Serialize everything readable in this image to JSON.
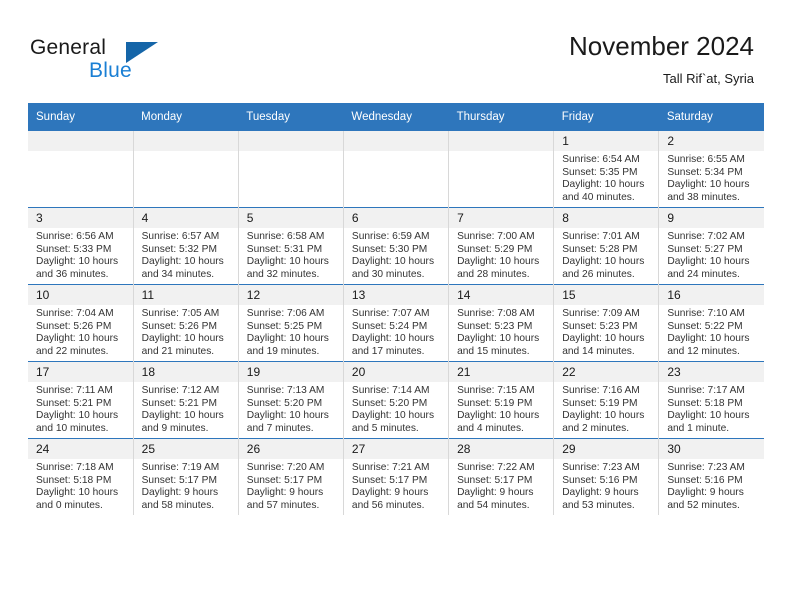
{
  "logo": {
    "word1": "General",
    "word2": "Blue",
    "triangle_color": "#1565a8",
    "blue_color": "#1a7fd4",
    "icon": "triangle-icon"
  },
  "header": {
    "title": "November 2024",
    "subtitle": "Tall Rif`at, Syria"
  },
  "theme": {
    "header_bg": "#2e76bc",
    "daynum_bg": "#f1f1f1",
    "cell_border": "#d8d8d8",
    "week_divider": "#2e76bc"
  },
  "weekdays": [
    "Sunday",
    "Monday",
    "Tuesday",
    "Wednesday",
    "Thursday",
    "Friday",
    "Saturday"
  ],
  "labels": {
    "sunrise": "Sunrise:",
    "sunset": "Sunset:",
    "daylight": "Daylight:"
  },
  "weeks": [
    [
      {
        "day": "",
        "empty": true
      },
      {
        "day": "",
        "empty": true
      },
      {
        "day": "",
        "empty": true
      },
      {
        "day": "",
        "empty": true
      },
      {
        "day": "",
        "empty": true
      },
      {
        "day": "1",
        "sunrise": "Sunrise: 6:54 AM",
        "sunset": "Sunset: 5:35 PM",
        "daylight": "Daylight: 10 hours and 40 minutes."
      },
      {
        "day": "2",
        "sunrise": "Sunrise: 6:55 AM",
        "sunset": "Sunset: 5:34 PM",
        "daylight": "Daylight: 10 hours and 38 minutes."
      }
    ],
    [
      {
        "day": "3",
        "sunrise": "Sunrise: 6:56 AM",
        "sunset": "Sunset: 5:33 PM",
        "daylight": "Daylight: 10 hours and 36 minutes."
      },
      {
        "day": "4",
        "sunrise": "Sunrise: 6:57 AM",
        "sunset": "Sunset: 5:32 PM",
        "daylight": "Daylight: 10 hours and 34 minutes."
      },
      {
        "day": "5",
        "sunrise": "Sunrise: 6:58 AM",
        "sunset": "Sunset: 5:31 PM",
        "daylight": "Daylight: 10 hours and 32 minutes."
      },
      {
        "day": "6",
        "sunrise": "Sunrise: 6:59 AM",
        "sunset": "Sunset: 5:30 PM",
        "daylight": "Daylight: 10 hours and 30 minutes."
      },
      {
        "day": "7",
        "sunrise": "Sunrise: 7:00 AM",
        "sunset": "Sunset: 5:29 PM",
        "daylight": "Daylight: 10 hours and 28 minutes."
      },
      {
        "day": "8",
        "sunrise": "Sunrise: 7:01 AM",
        "sunset": "Sunset: 5:28 PM",
        "daylight": "Daylight: 10 hours and 26 minutes."
      },
      {
        "day": "9",
        "sunrise": "Sunrise: 7:02 AM",
        "sunset": "Sunset: 5:27 PM",
        "daylight": "Daylight: 10 hours and 24 minutes."
      }
    ],
    [
      {
        "day": "10",
        "sunrise": "Sunrise: 7:04 AM",
        "sunset": "Sunset: 5:26 PM",
        "daylight": "Daylight: 10 hours and 22 minutes."
      },
      {
        "day": "11",
        "sunrise": "Sunrise: 7:05 AM",
        "sunset": "Sunset: 5:26 PM",
        "daylight": "Daylight: 10 hours and 21 minutes."
      },
      {
        "day": "12",
        "sunrise": "Sunrise: 7:06 AM",
        "sunset": "Sunset: 5:25 PM",
        "daylight": "Daylight: 10 hours and 19 minutes."
      },
      {
        "day": "13",
        "sunrise": "Sunrise: 7:07 AM",
        "sunset": "Sunset: 5:24 PM",
        "daylight": "Daylight: 10 hours and 17 minutes."
      },
      {
        "day": "14",
        "sunrise": "Sunrise: 7:08 AM",
        "sunset": "Sunset: 5:23 PM",
        "daylight": "Daylight: 10 hours and 15 minutes."
      },
      {
        "day": "15",
        "sunrise": "Sunrise: 7:09 AM",
        "sunset": "Sunset: 5:23 PM",
        "daylight": "Daylight: 10 hours and 14 minutes."
      },
      {
        "day": "16",
        "sunrise": "Sunrise: 7:10 AM",
        "sunset": "Sunset: 5:22 PM",
        "daylight": "Daylight: 10 hours and 12 minutes."
      }
    ],
    [
      {
        "day": "17",
        "sunrise": "Sunrise: 7:11 AM",
        "sunset": "Sunset: 5:21 PM",
        "daylight": "Daylight: 10 hours and 10 minutes."
      },
      {
        "day": "18",
        "sunrise": "Sunrise: 7:12 AM",
        "sunset": "Sunset: 5:21 PM",
        "daylight": "Daylight: 10 hours and 9 minutes."
      },
      {
        "day": "19",
        "sunrise": "Sunrise: 7:13 AM",
        "sunset": "Sunset: 5:20 PM",
        "daylight": "Daylight: 10 hours and 7 minutes."
      },
      {
        "day": "20",
        "sunrise": "Sunrise: 7:14 AM",
        "sunset": "Sunset: 5:20 PM",
        "daylight": "Daylight: 10 hours and 5 minutes."
      },
      {
        "day": "21",
        "sunrise": "Sunrise: 7:15 AM",
        "sunset": "Sunset: 5:19 PM",
        "daylight": "Daylight: 10 hours and 4 minutes."
      },
      {
        "day": "22",
        "sunrise": "Sunrise: 7:16 AM",
        "sunset": "Sunset: 5:19 PM",
        "daylight": "Daylight: 10 hours and 2 minutes."
      },
      {
        "day": "23",
        "sunrise": "Sunrise: 7:17 AM",
        "sunset": "Sunset: 5:18 PM",
        "daylight": "Daylight: 10 hours and 1 minute."
      }
    ],
    [
      {
        "day": "24",
        "sunrise": "Sunrise: 7:18 AM",
        "sunset": "Sunset: 5:18 PM",
        "daylight": "Daylight: 10 hours and 0 minutes."
      },
      {
        "day": "25",
        "sunrise": "Sunrise: 7:19 AM",
        "sunset": "Sunset: 5:17 PM",
        "daylight": "Daylight: 9 hours and 58 minutes."
      },
      {
        "day": "26",
        "sunrise": "Sunrise: 7:20 AM",
        "sunset": "Sunset: 5:17 PM",
        "daylight": "Daylight: 9 hours and 57 minutes."
      },
      {
        "day": "27",
        "sunrise": "Sunrise: 7:21 AM",
        "sunset": "Sunset: 5:17 PM",
        "daylight": "Daylight: 9 hours and 56 minutes."
      },
      {
        "day": "28",
        "sunrise": "Sunrise: 7:22 AM",
        "sunset": "Sunset: 5:17 PM",
        "daylight": "Daylight: 9 hours and 54 minutes."
      },
      {
        "day": "29",
        "sunrise": "Sunrise: 7:23 AM",
        "sunset": "Sunset: 5:16 PM",
        "daylight": "Daylight: 9 hours and 53 minutes."
      },
      {
        "day": "30",
        "sunrise": "Sunrise: 7:23 AM",
        "sunset": "Sunset: 5:16 PM",
        "daylight": "Daylight: 9 hours and 52 minutes."
      }
    ]
  ]
}
